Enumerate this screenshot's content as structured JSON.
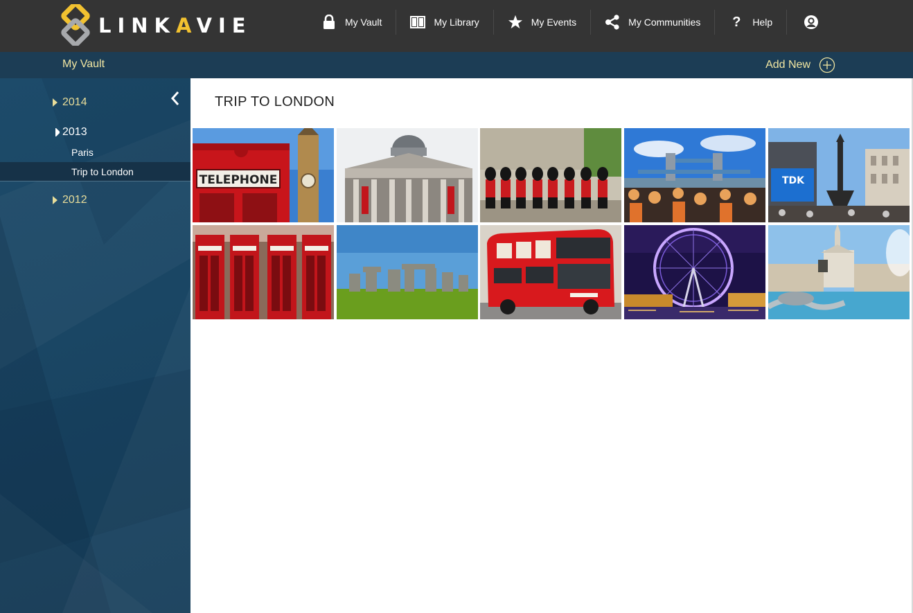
{
  "brand": {
    "name_part1": "LINK",
    "name_accent": "A",
    "name_part2": "VIE",
    "colors": {
      "gold": "#f2c230",
      "gray": "#a7a9ac",
      "bar": "#343434"
    }
  },
  "nav": {
    "items": [
      {
        "label": "My Vault",
        "icon": "lock-icon"
      },
      {
        "label": "My Library",
        "icon": "book-icon"
      },
      {
        "label": "My Events",
        "icon": "star-icon"
      },
      {
        "label": "My Communities",
        "icon": "share-icon"
      },
      {
        "label": "Help",
        "icon": "help-icon",
        "glyph": "?"
      }
    ],
    "avatar_icon": "user-avatar-icon"
  },
  "subheader": {
    "title": "My Vault",
    "add_new_label": "Add New",
    "accent_color": "#f1e6a2"
  },
  "sidebar": {
    "collapse_icon": "chevron-left-icon",
    "years": [
      {
        "label": "2014",
        "expanded": false
      },
      {
        "label": "2013",
        "expanded": true,
        "albums": [
          {
            "label": "Paris",
            "selected": false
          },
          {
            "label": "Trip to London",
            "selected": true
          }
        ]
      },
      {
        "label": "2012",
        "expanded": false
      }
    ]
  },
  "album": {
    "title": "TRIP TO LONDON",
    "photos": [
      {
        "subject": "telephone-booth-big-ben",
        "caption": "TELEPHONE"
      },
      {
        "subject": "national-gallery"
      },
      {
        "subject": "queens-guard-parade"
      },
      {
        "subject": "tower-bridge-crowd"
      },
      {
        "subject": "piccadilly-circus",
        "caption": "TDK"
      },
      {
        "subject": "red-phone-boxes"
      },
      {
        "subject": "stonehenge"
      },
      {
        "subject": "red-double-decker-bus"
      },
      {
        "subject": "london-eye-night"
      },
      {
        "subject": "trafalgar-square-fountain"
      }
    ]
  }
}
